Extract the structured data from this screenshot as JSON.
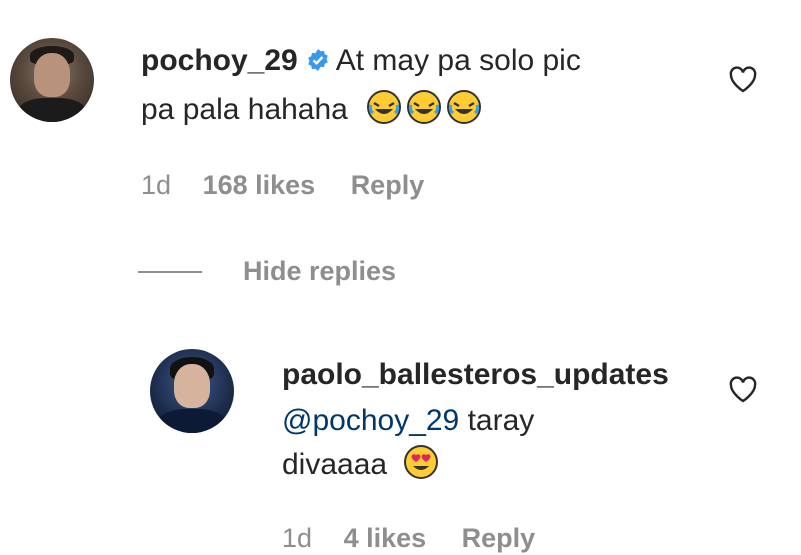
{
  "comment": {
    "username": "pochoy_29",
    "text_line1": "At may pa solo pic",
    "text_line2": "pa pala hahaha",
    "time": "1d",
    "likes": "168 likes",
    "reply": "Reply"
  },
  "replies_toggle": {
    "label": "Hide replies"
  },
  "reply": {
    "username": "paolo_ballesteros_updates",
    "mention": "@pochoy_29",
    "text_rest": " taray",
    "text_line2": "divaaaa",
    "time": "1d",
    "likes": "4 likes",
    "reply": "Reply"
  },
  "icons": {
    "verified_color": "#3897f0",
    "emoji_laugh": "rolling-on-floor-laughing",
    "emoji_heart_eyes": "smiling-face-with-heart-eyes"
  }
}
